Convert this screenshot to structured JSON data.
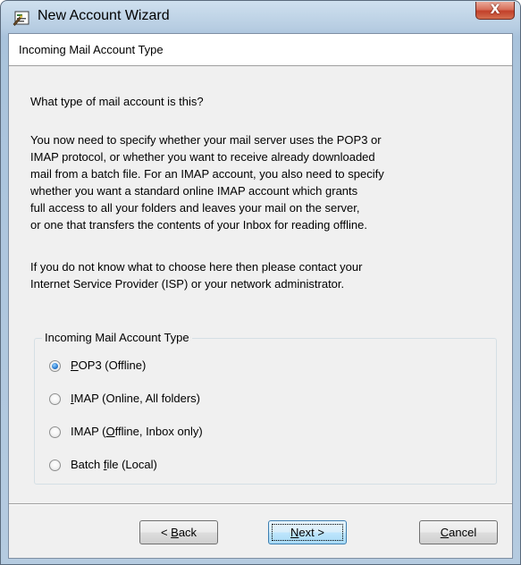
{
  "window": {
    "title": "New Account Wizard",
    "title_icon": "wizard-icon",
    "close_glyph": "X"
  },
  "header": {
    "title": "Incoming Mail Account Type"
  },
  "body": {
    "question": "What type of mail account is this?",
    "paragraph1": "You now need to specify whether your mail server uses the POP3 or\nIMAP protocol, or whether you want to receive already downloaded\nmail from a batch file.  For an IMAP account, you also need to specify\nwhether you want a standard online IMAP account which grants\nfull access to all your folders and leaves your mail on the server,\nor one that transfers the contents of your Inbox for reading offline.",
    "paragraph2": "If you do not know what to choose here then please contact your\nInternet Service Provider (ISP) or your network administrator."
  },
  "group": {
    "label": "Incoming Mail Account Type",
    "options": [
      {
        "label": "POP3 (Offline)",
        "mnemonic": "P",
        "selected": true
      },
      {
        "label": "IMAP (Online, All folders)",
        "mnemonic": "I",
        "selected": false
      },
      {
        "label": "IMAP (Offline, Inbox only)",
        "mnemonic": "O",
        "selected": false
      },
      {
        "label": "Batch file (Local)",
        "mnemonic": "f",
        "selected": false
      }
    ]
  },
  "buttons": {
    "back": "< Back",
    "next": "Next >",
    "cancel": "Cancel"
  },
  "colors": {
    "titlebar": "#b7cde2",
    "close_button": "#c2402a",
    "dialog_bg": "#f0f0f0",
    "default_button": "#bee6fd"
  }
}
